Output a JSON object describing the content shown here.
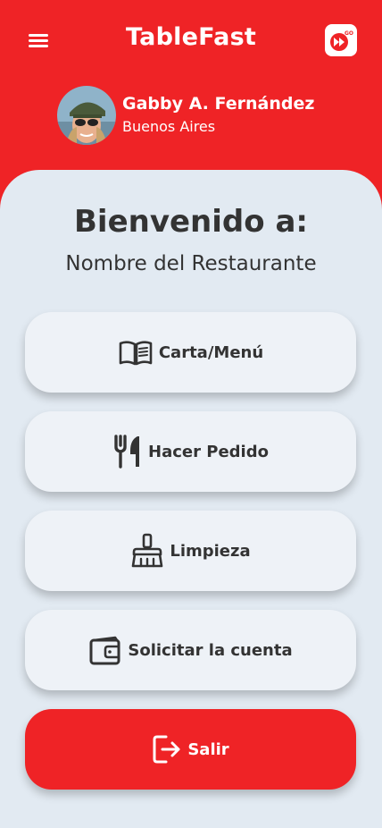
{
  "header": {
    "title": "TableFast",
    "menu_icon": "hamburger-icon",
    "logo_icon": "fast-forward-go-icon",
    "logo_badge": "GO"
  },
  "profile": {
    "name": "Gabby A. Fernández",
    "city": "Buenos Aires",
    "avatar": "user-photo"
  },
  "main": {
    "welcome": "Bienvenido a:",
    "restaurant_name": "Nombre del Restaurante"
  },
  "actions": [
    {
      "label": "Carta/Menú",
      "icon": "open-book-icon"
    },
    {
      "label": "Hacer Pedido",
      "icon": "utensils-icon"
    },
    {
      "label": "Limpieza",
      "icon": "broom-icon"
    },
    {
      "label": "Solicitar la cuenta",
      "icon": "wallet-icon"
    },
    {
      "label": "Salir",
      "icon": "sign-out-icon"
    }
  ],
  "colors": {
    "primary": "#ef2326",
    "panel_bg": "#e2eaf2",
    "button_bg": "#eef2f7",
    "text_dark": "#333333"
  }
}
